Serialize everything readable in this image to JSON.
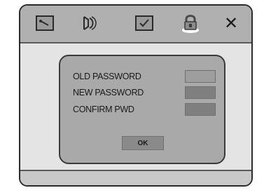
{
  "toolbar": {
    "icons": [
      "settings-icon",
      "audio-icon",
      "checkbox-icon",
      "lock-icon",
      "close-icon"
    ],
    "close_label": "✕"
  },
  "dialog": {
    "old_password_label": "OLD PASSWORD",
    "new_password_label": "NEW PASSWORD",
    "confirm_pwd_label": "CONFIRM PWD",
    "ok_label": "OK"
  }
}
